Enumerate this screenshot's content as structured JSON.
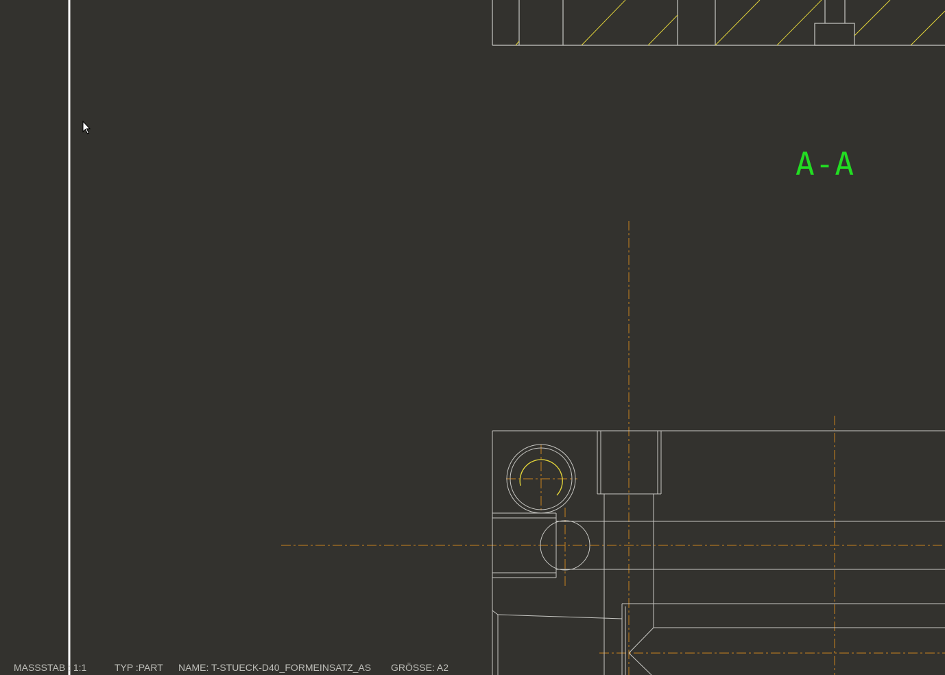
{
  "drawing": {
    "section_label": "A-A"
  },
  "status_bar": {
    "scale": "MASSSTAB : 1:1",
    "type": "TYP :PART",
    "name": "NAME: T-STUECK-D40_FORMEINSATZ_AS",
    "size": "GRÖSSE: A2"
  },
  "colors": {
    "background": "#33322e",
    "geometry_line": "#c8c8c4",
    "hatch": "#e0d23a",
    "centerline": "#c8821e",
    "section_label": "#22dd22",
    "border": "#ffffff"
  },
  "icons": [
    "mouse-cursor-icon"
  ]
}
